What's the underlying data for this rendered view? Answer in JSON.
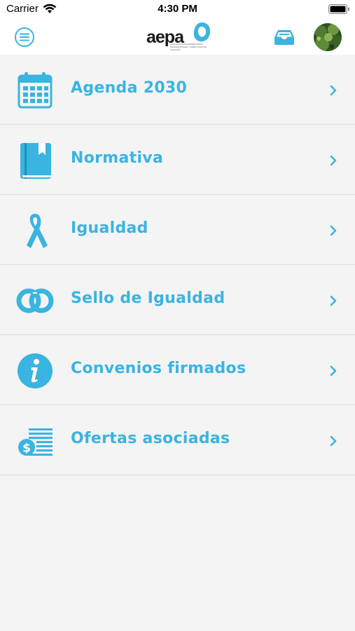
{
  "status_bar": {
    "carrier": "Carrier",
    "time": "4:30 PM",
    "icons": [
      "wifi-icon",
      "battery-icon"
    ]
  },
  "nav_bar": {
    "menu_icon": "hamburger-menu-icon",
    "logo_text": "aepa",
    "logo_subtitle": "Asociación de Empresarias, Profesionales y Directivas de Alicante",
    "inbox_icon": "inbox-tray-icon",
    "avatar_icon": "avatar"
  },
  "theme": {
    "accent": "#3ab4e0",
    "background": "#f4f4f4",
    "divider": "#dedede"
  },
  "menu": {
    "items": [
      {
        "label": "Agenda 2030",
        "icon": "calendar-icon"
      },
      {
        "label": "Normativa",
        "icon": "book-icon"
      },
      {
        "label": "Igualdad",
        "icon": "ribbon-icon"
      },
      {
        "label": "Sello de Igualdad",
        "icon": "interlocked-rings-icon"
      },
      {
        "label": "Convenios firmados",
        "icon": "info-icon"
      },
      {
        "label": "Ofertas asociadas",
        "icon": "money-list-icon"
      }
    ],
    "chevron_icon": "chevron-right-icon"
  }
}
